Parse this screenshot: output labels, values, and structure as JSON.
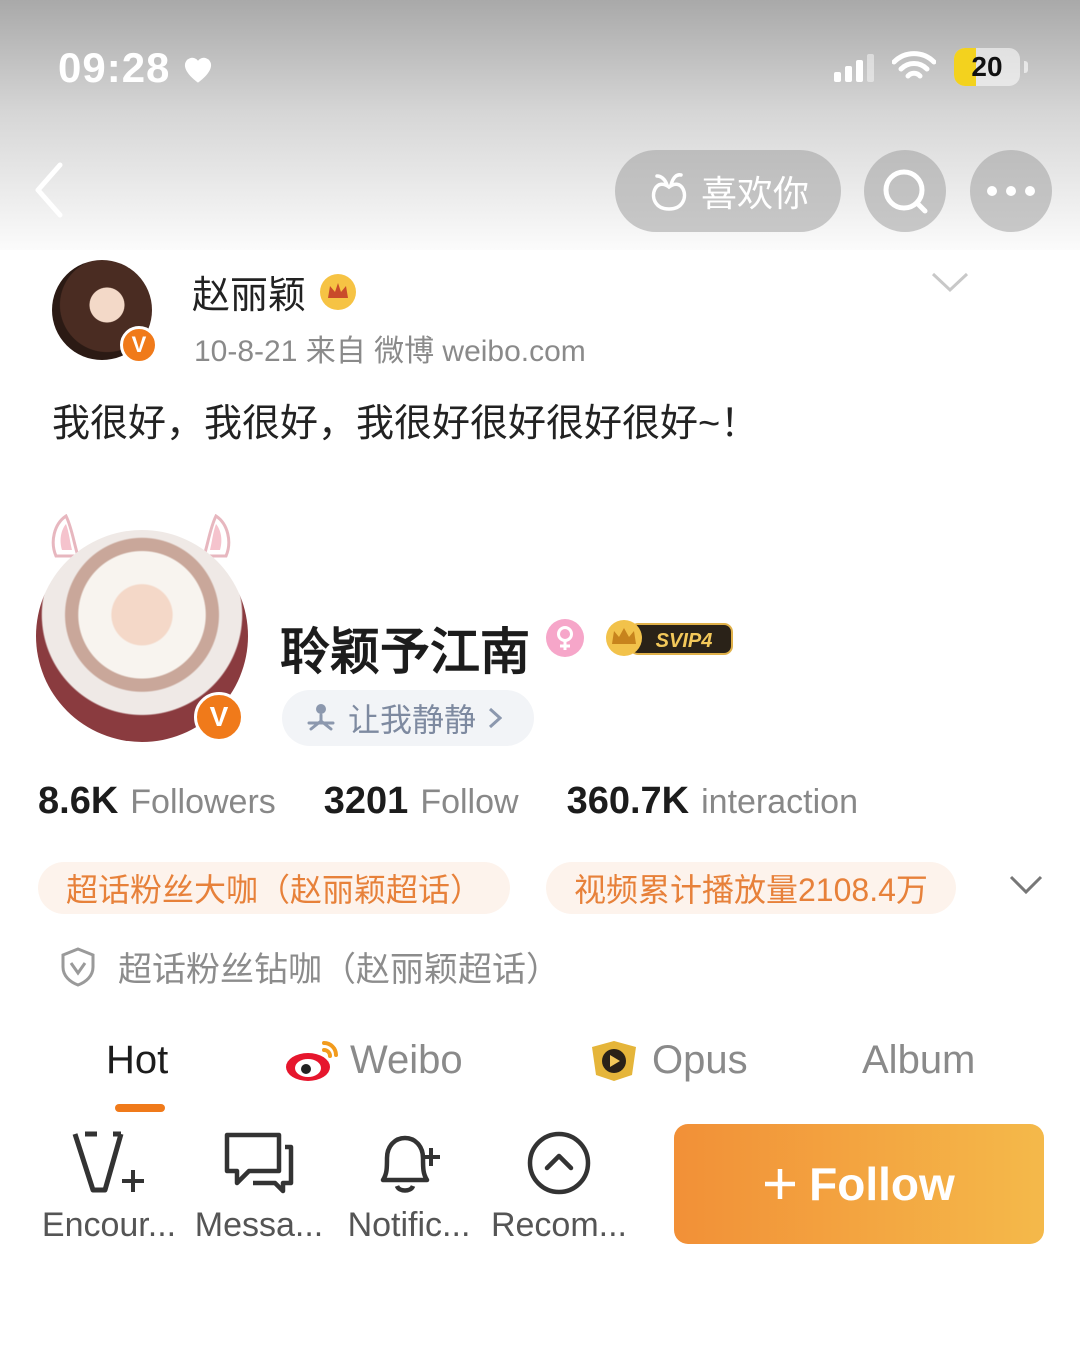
{
  "status_bar": {
    "time": "09:28",
    "battery": "20"
  },
  "nav": {
    "like_label": "喜欢你"
  },
  "post": {
    "author": "赵丽颖",
    "meta": "10-8-21  来自 微博 weibo.com",
    "text": "我很好，我很好，我很好很好很好很好~！"
  },
  "profile": {
    "name": "聆颖予江南",
    "vip_badge": "SVIP4",
    "status": "让我静静",
    "stats": [
      {
        "num": "8.6K",
        "label": "Followers"
      },
      {
        "num": "3201",
        "label": "Follow"
      },
      {
        "num": "360.7K",
        "label": "interaction"
      }
    ],
    "tags": [
      "超话粉丝大咖（赵丽颖超话）",
      "视频累计播放量2108.4万"
    ],
    "badge_line": "超话粉丝钻咖（赵丽颖超话）"
  },
  "tabs": [
    "Hot",
    "Weibo",
    "Opus",
    "Album"
  ],
  "bottom": {
    "items": [
      "Encour...",
      "Messa...",
      "Notific...",
      "Recom..."
    ],
    "follow_label": "Follow"
  },
  "colors": {
    "accent": "#f07a1a",
    "follow_start": "#f29037",
    "follow_end": "#f4b94a"
  }
}
